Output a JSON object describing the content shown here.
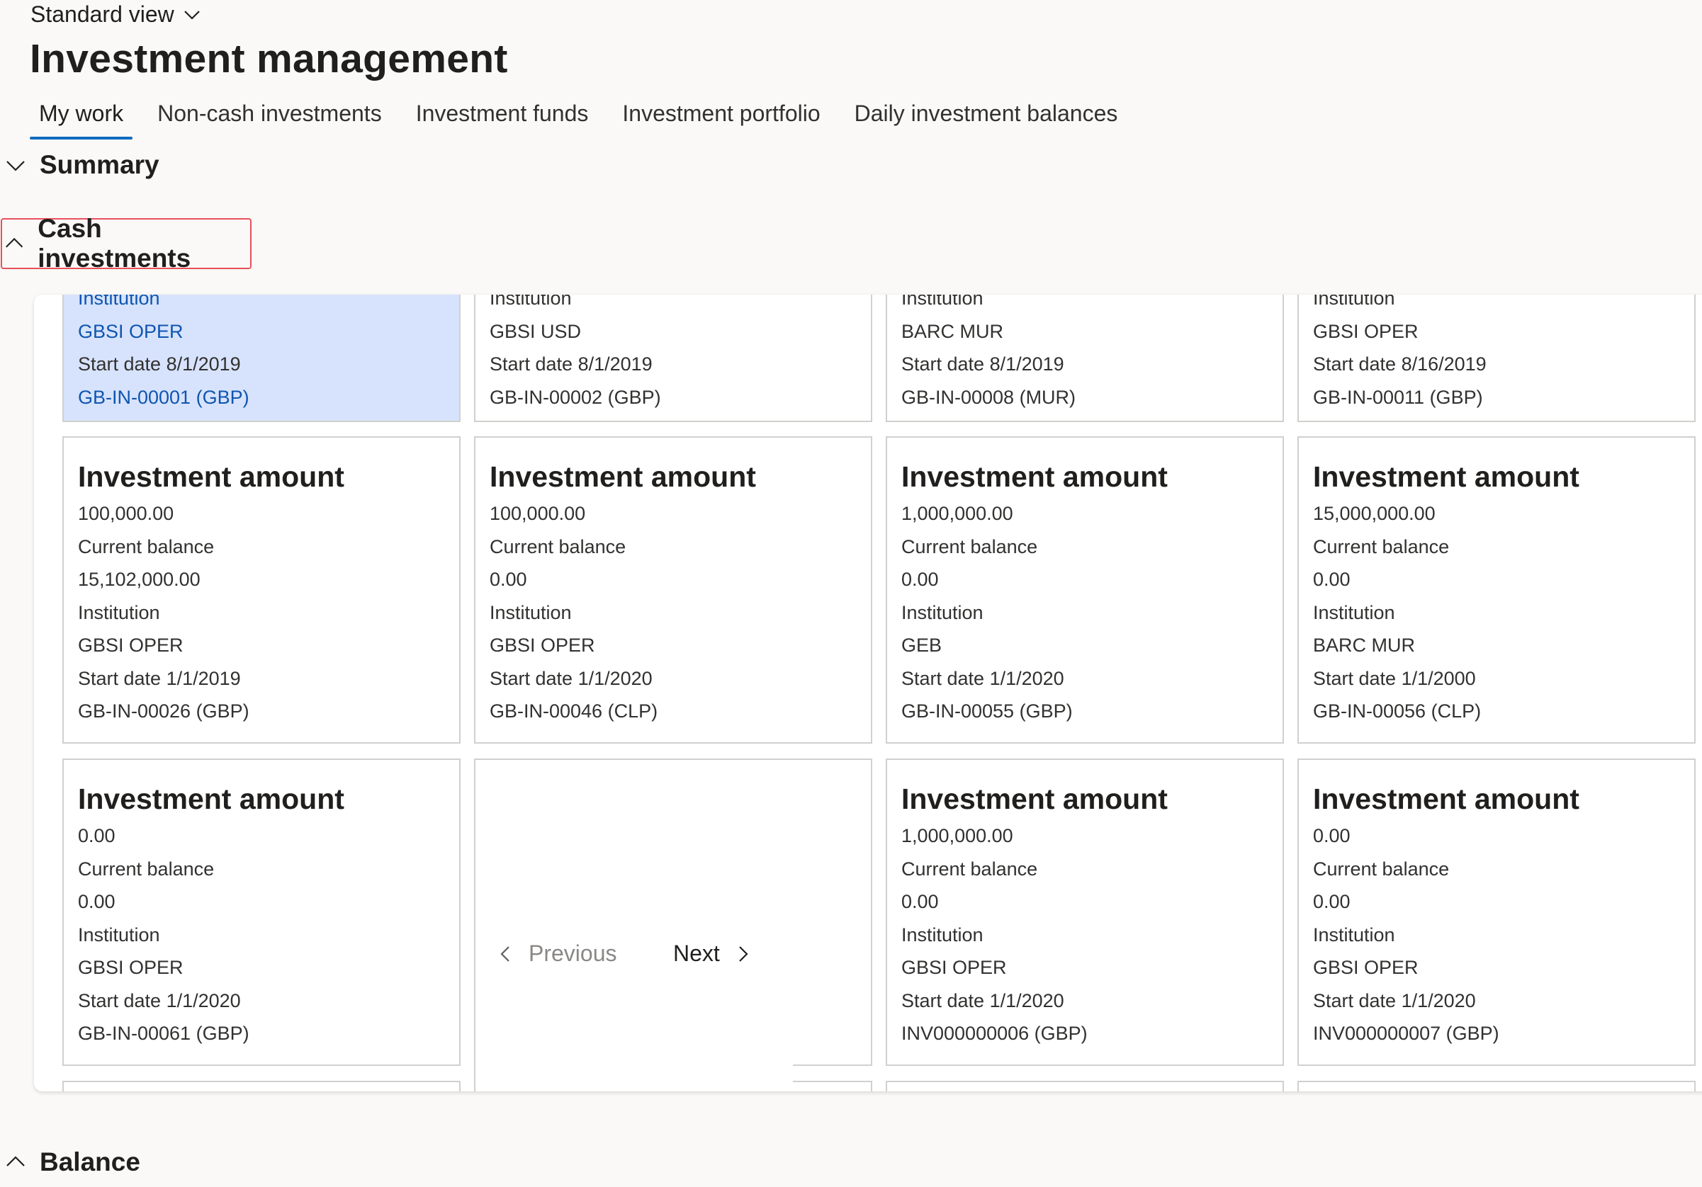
{
  "header": {
    "view_label": "Standard view",
    "title": "Investment management"
  },
  "tabs": [
    {
      "label": "My work",
      "active": true
    },
    {
      "label": "Non-cash investments",
      "active": false
    },
    {
      "label": "Investment funds",
      "active": false
    },
    {
      "label": "Investment portfolio",
      "active": false
    },
    {
      "label": "Daily investment balances",
      "active": false
    }
  ],
  "sections": {
    "summary": "Summary",
    "cash_investments": "Cash investments",
    "balance": "Balance"
  },
  "top_row": [
    {
      "partial_label": "Institution",
      "institution": "GBSI OPER",
      "start": "Start date 8/1/2019",
      "id": "GB-IN-00001 (GBP)"
    },
    {
      "partial_label": "Institution",
      "institution": "GBSI USD",
      "start": "Start date 8/1/2019",
      "id": "GB-IN-00002 (GBP)"
    },
    {
      "partial_label": "Institution",
      "institution": "BARC MUR",
      "start": "Start date 8/1/2019",
      "id": "GB-IN-00008 (MUR)"
    },
    {
      "partial_label": "Institution",
      "institution": "GBSI OPER",
      "start": "Start date 8/16/2019",
      "id": "GB-IN-00011 (GBP)"
    }
  ],
  "cards": [
    {
      "title": "Investment amount",
      "amount": "100,000.00",
      "balance_label": "Current balance",
      "balance": "15,102,000.00",
      "institution_label": "Institution",
      "institution": "GBSI OPER",
      "start": "Start date 1/1/2019",
      "id": "GB-IN-00026 (GBP)"
    },
    {
      "title": "Investment amount",
      "amount": "100,000.00",
      "balance_label": "Current balance",
      "balance": "0.00",
      "institution_label": "Institution",
      "institution": "GBSI OPER",
      "start": "Start date 1/1/2020",
      "id": "GB-IN-00046 (CLP)"
    },
    {
      "title": "Investment amount",
      "amount": "1,000,000.00",
      "balance_label": "Current balance",
      "balance": "0.00",
      "institution_label": "Institution",
      "institution": "GEB",
      "start": "Start date 1/1/2020",
      "id": "GB-IN-00055 (GBP)"
    },
    {
      "title": "Investment amount",
      "amount": "15,000,000.00",
      "balance_label": "Current balance",
      "balance": "0.00",
      "institution_label": "Institution",
      "institution": "BARC MUR",
      "start": "Start date 1/1/2000",
      "id": "GB-IN-00056 (CLP)"
    },
    {
      "title": "Investment amount",
      "amount": "0.00",
      "balance_label": "Current balance",
      "balance": "0.00",
      "institution_label": "Institution",
      "institution": "GBSI OPER",
      "start": "Start date 1/1/2020",
      "id": "GB-IN-00061 (GBP)"
    },
    {
      "title": "Investment amount",
      "amount": "1,000,000.00",
      "balance_label": "Current balance",
      "balance": "0.00",
      "institution_label": "Institution",
      "institution": "GBSI OPER",
      "start": "Start date 1/1/2020",
      "id": "INV000000006 (GBP)"
    },
    {
      "title": "Investment amount",
      "amount": "0.00",
      "balance_label": "Current balance",
      "balance": "0.00",
      "institution_label": "Institution",
      "institution": "GBSI OPER",
      "start": "Start date 1/1/2020",
      "id": "INV000000007 (GBP)"
    }
  ],
  "pager": {
    "previous": "Previous",
    "next": "Next"
  }
}
